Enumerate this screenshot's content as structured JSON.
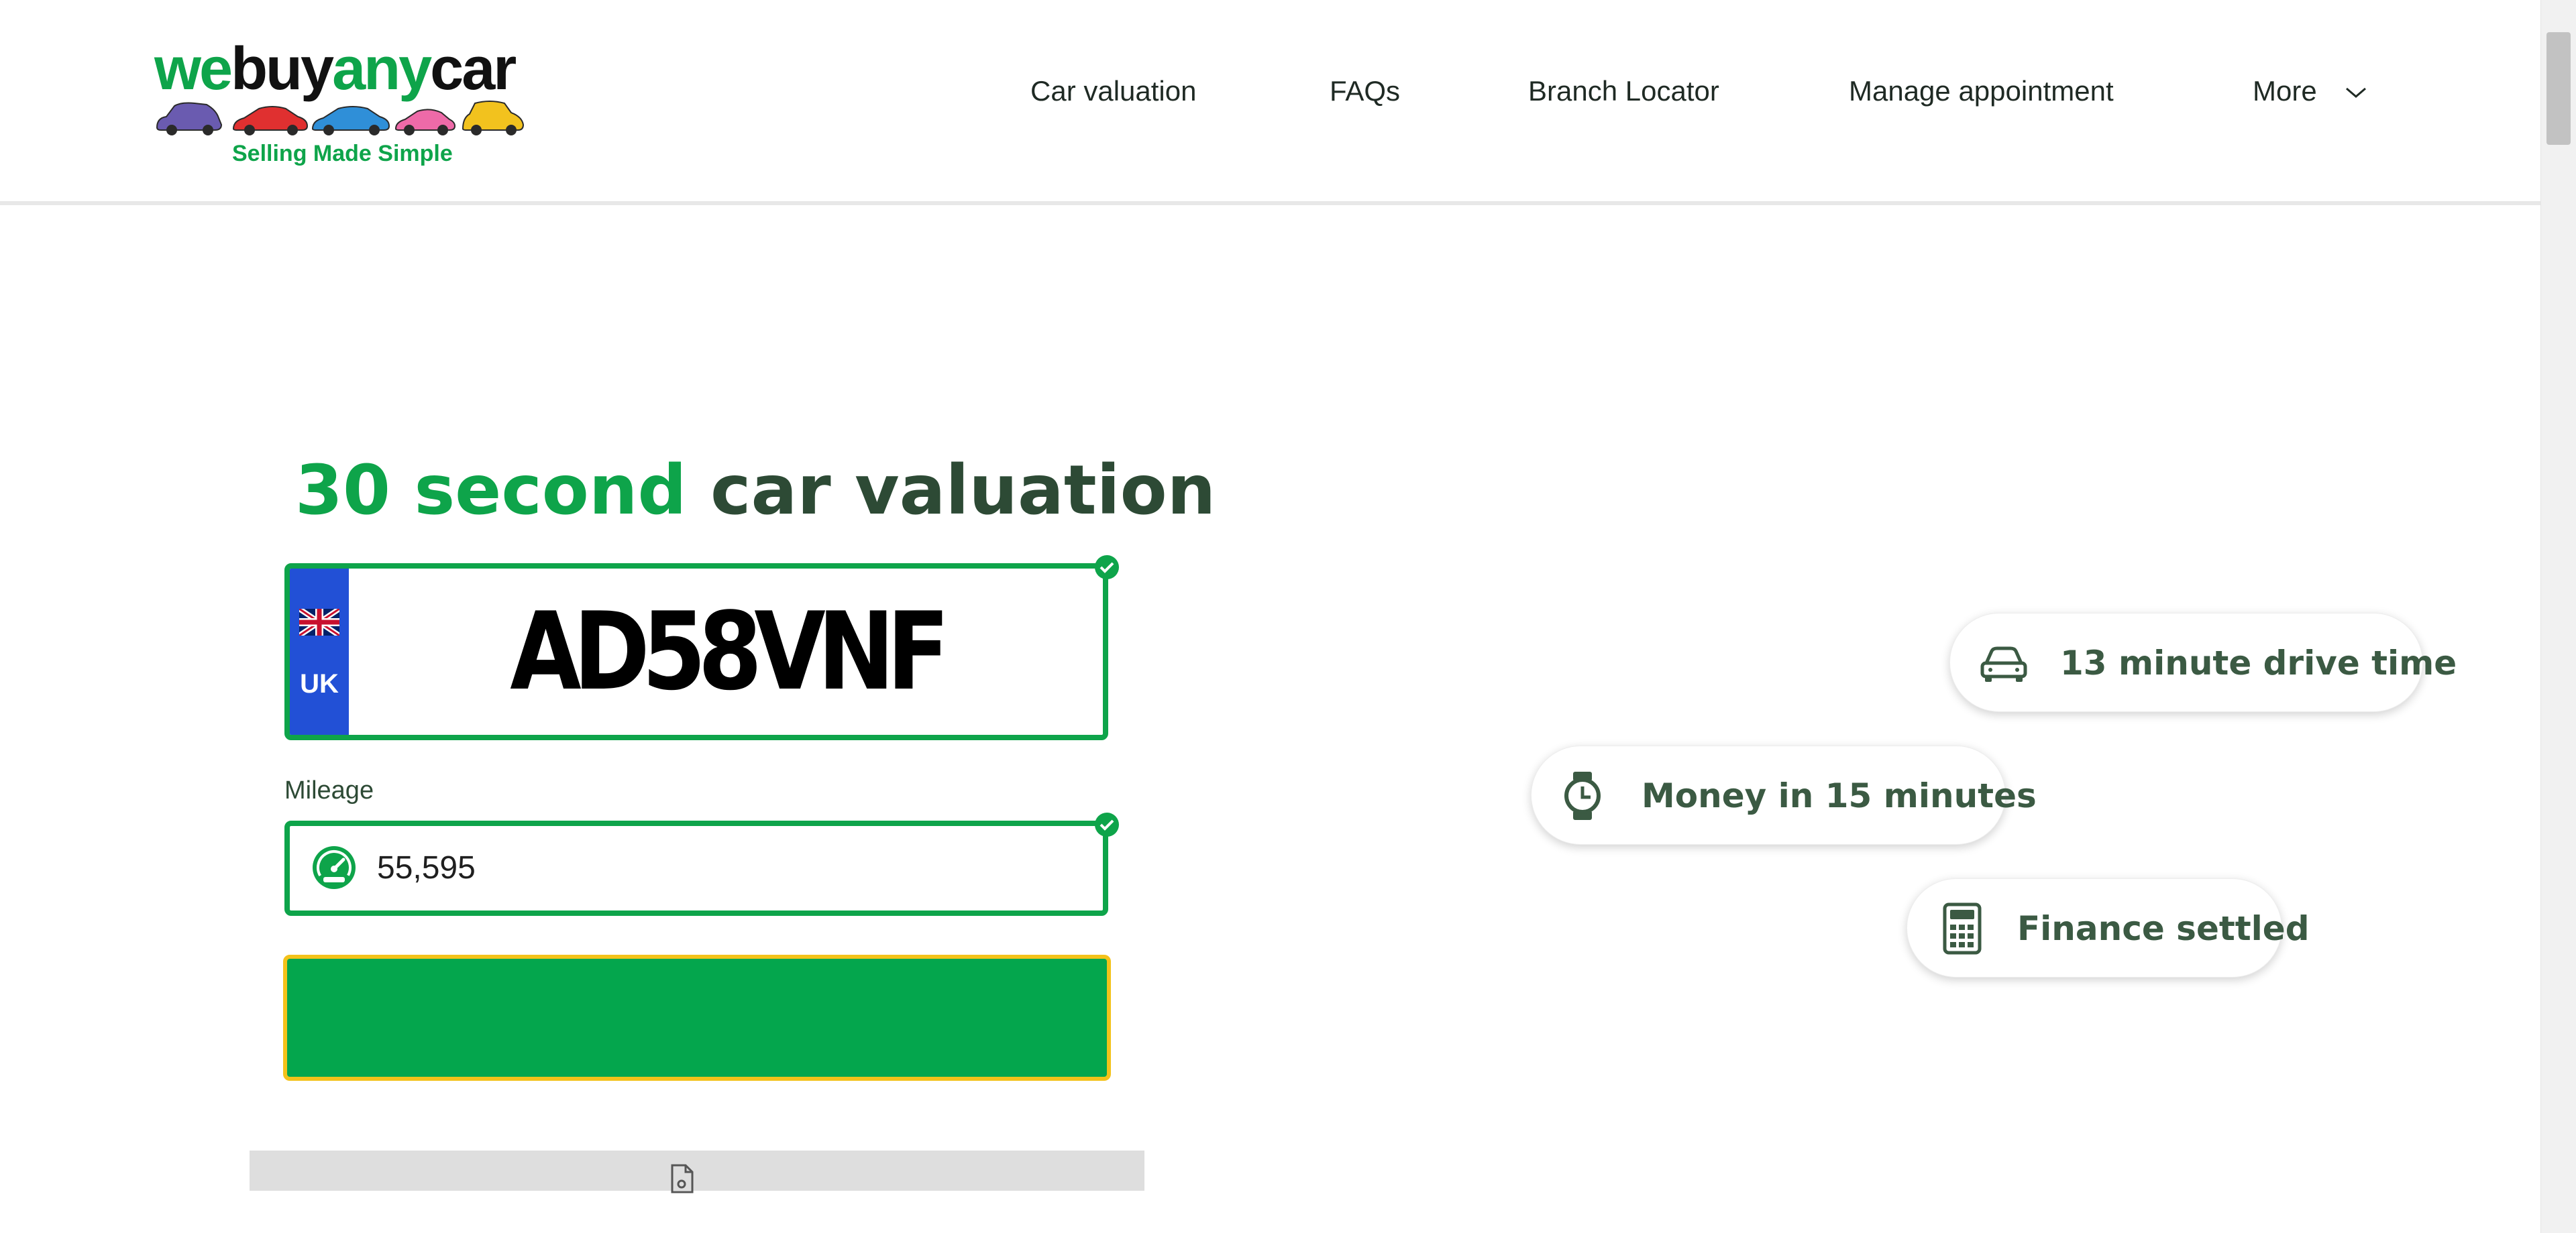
{
  "brand": {
    "logo_part1": "we",
    "logo_part2": "buy",
    "logo_part3": "any",
    "logo_part4": "car",
    "tagline": "Selling Made Simple"
  },
  "nav": {
    "items": [
      {
        "label": "Car valuation"
      },
      {
        "label": "FAQs"
      },
      {
        "label": "Branch Locator"
      },
      {
        "label": "Manage appointment"
      },
      {
        "label": "More"
      }
    ]
  },
  "valuation": {
    "headline_green": "30 second",
    "headline_dark": "car valuation",
    "plate": {
      "country": "UK",
      "registration": "AD58VNF"
    },
    "mileage": {
      "label": "Mileage",
      "value": "55,595"
    },
    "submit_label": ""
  },
  "features": [
    {
      "icon": "car-icon",
      "label": "13 minute drive time"
    },
    {
      "icon": "watch-icon",
      "label": "Money in 15 minutes"
    },
    {
      "icon": "calculator-icon",
      "label": "Finance settled"
    }
  ],
  "colors": {
    "brand_green": "#0ea44a",
    "dark_green_text": "#2d4a35",
    "button_green": "#04a64d",
    "focus_yellow": "#f3c21a",
    "plate_blue": "#2250d6"
  }
}
